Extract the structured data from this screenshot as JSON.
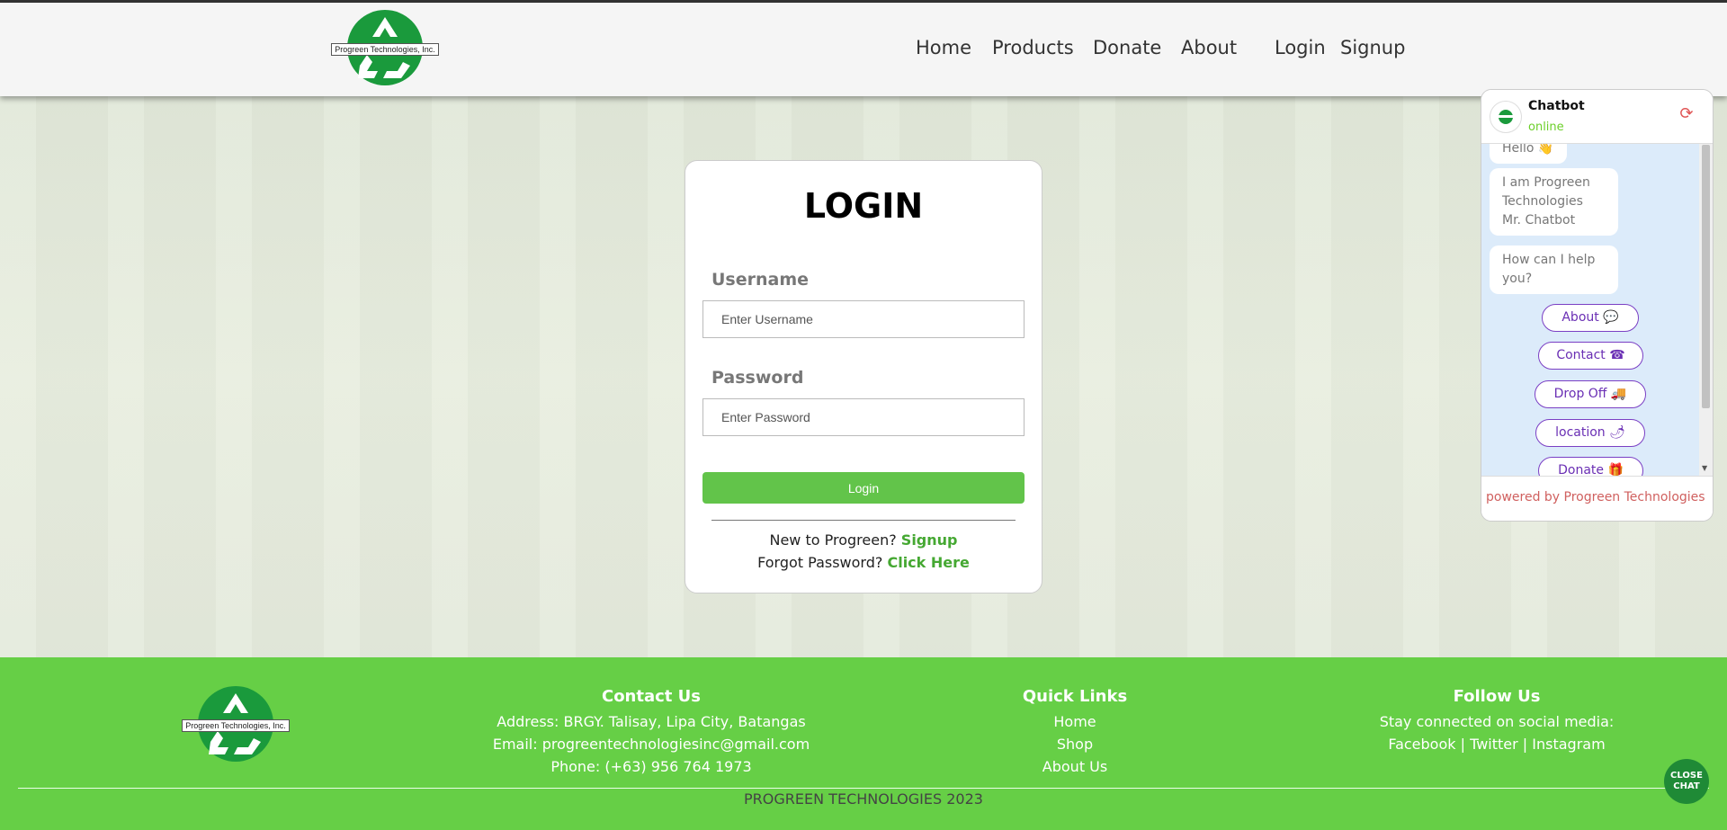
{
  "brand": {
    "name": "Progreen Technologies, Inc."
  },
  "nav": {
    "links": [
      "Home",
      "Products",
      "Donate",
      "About",
      "Login",
      "Signup"
    ]
  },
  "login": {
    "title": "LOGIN",
    "username_label": "Username",
    "username_placeholder": "Enter Username",
    "password_label": "Password",
    "password_placeholder": "Enter Password",
    "submit_label": "Login",
    "signup_prompt": "New to Progreen?",
    "signup_link": "Signup",
    "forgot_prompt": "Forgot Password?",
    "forgot_link": "Click Here"
  },
  "chatbot": {
    "title": "Chatbot",
    "status": "online",
    "messages": [
      "Hello 👋",
      "I am Progreen Technologies Mr. Chatbot",
      "How can I help you?"
    ],
    "options": [
      "About 💬",
      "Contact ☎",
      "Drop Off 🚚",
      "location 🌶",
      "Donate 🎁"
    ],
    "powered_by": "powered by Progreen Technologies",
    "close_label": "CLOSE CHAT"
  },
  "footer": {
    "contact": {
      "heading": "Contact Us",
      "address": "Address: BRGY. Talisay, Lipa City, Batangas",
      "email": "Email: progreentechnologiesinc@gmail.com",
      "phone": "Phone: (+63) 956 764 1973"
    },
    "quick_links": {
      "heading": "Quick Links",
      "links": [
        "Home",
        "Shop",
        "About Us"
      ]
    },
    "follow": {
      "heading": "Follow Us",
      "text": "Stay connected on social media:",
      "social_line": "Facebook | Twitter | Instagram"
    },
    "copyright": "PROGREEN TECHNOLOGIES 2023"
  },
  "colors": {
    "accent_green": "#66cf46",
    "link_green": "#45a832",
    "chat_purple": "#7a3fc4"
  }
}
